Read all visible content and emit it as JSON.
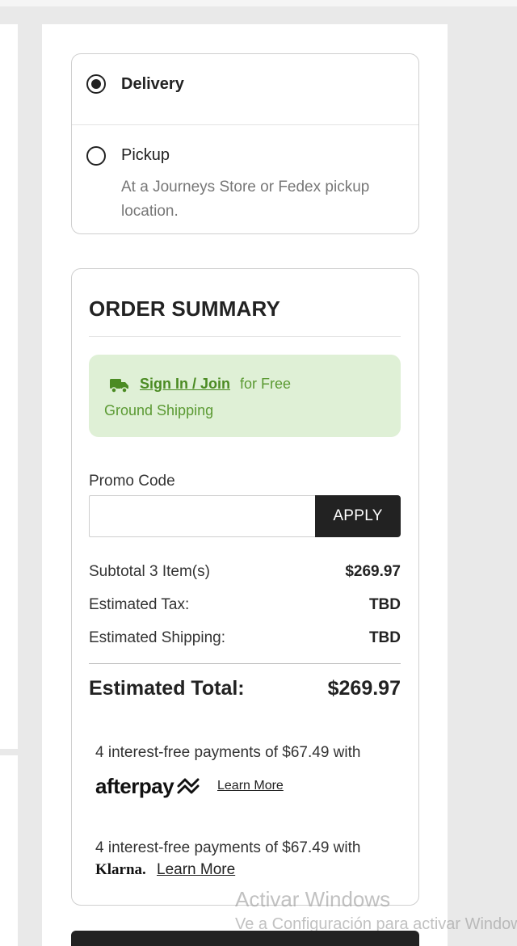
{
  "fulfillment": {
    "delivery_label": "Delivery",
    "delivery_selected": true,
    "pickup_label": "Pickup",
    "pickup_description": "At a Journeys Store or Fedex pickup location."
  },
  "order_summary": {
    "title": "ORDER SUMMARY",
    "shipping_banner": {
      "link_text": "Sign In / Join",
      "text_line1": "for Free",
      "text_line2": "Ground Shipping",
      "icon": "truck-icon",
      "background_color": "#dff0d6",
      "text_color": "#5b9a33"
    },
    "promo": {
      "label": "Promo Code",
      "value": "",
      "placeholder": "",
      "button_label": "APPLY"
    },
    "rows": [
      {
        "label": "Subtotal 3 Item(s)",
        "value": "$269.97"
      },
      {
        "label": "Estimated Tax:",
        "value": "TBD"
      },
      {
        "label": "Estimated Shipping:",
        "value": "TBD"
      }
    ],
    "total": {
      "label": "Estimated Total:",
      "value": "$269.97"
    },
    "afterpay": {
      "text": "4 interest-free payments of $67.49 with",
      "logo_text": "afterpay",
      "learn_more": "Learn More"
    },
    "klarna": {
      "text": "4 interest-free payments of $67.49 with",
      "logo_text": "Klarna.",
      "learn_more": "Learn More"
    }
  },
  "os_watermark": {
    "line1": "Activar Windows",
    "line2": "Ve a Configuración para activar Windows."
  }
}
